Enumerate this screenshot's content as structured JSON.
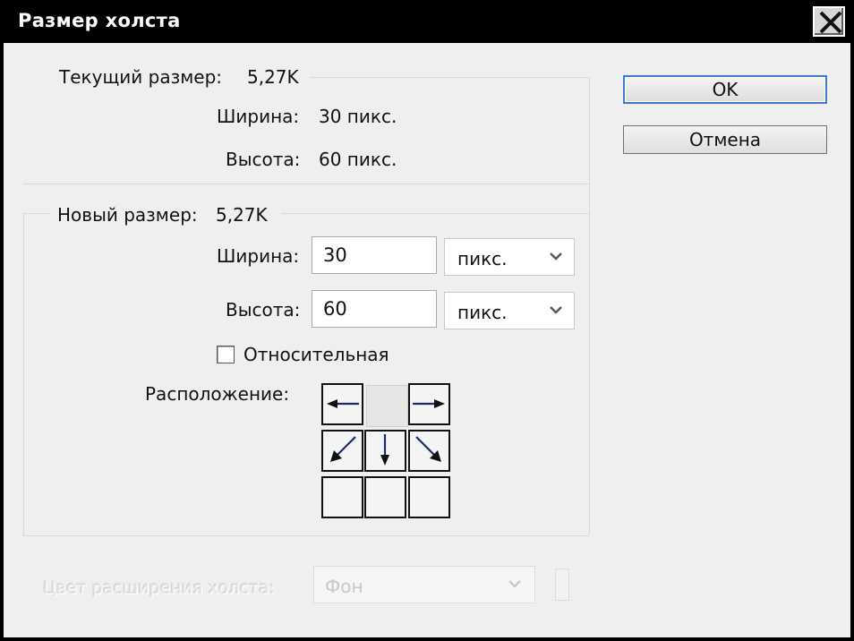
{
  "window": {
    "title": "Размер холста"
  },
  "current_size": {
    "label": "Текущий размер:",
    "value": "5,27K",
    "width_label": "Ширина:",
    "width_value": "30 пикс.",
    "height_label": "Высота:",
    "height_value": "60 пикс."
  },
  "new_size": {
    "label": "Новый размер:",
    "value": "5,27K",
    "width_label": "Ширина:",
    "width_value": "30",
    "width_unit": "пикс.",
    "height_label": "Высота:",
    "height_value": "60",
    "height_unit": "пикс.",
    "relative_label": "Относительная",
    "relative_checked": false,
    "anchor_label": "Расположение:",
    "anchor_position": "top-center"
  },
  "buttons": {
    "ok": "OK",
    "cancel": "Отмена"
  },
  "extension_color": {
    "label": "Цвет расширения холста:",
    "value": "Фон",
    "enabled": false
  },
  "icons": [
    "close-icon",
    "chevron-down-icon",
    "checkbox-icon",
    "arrow-left-icon",
    "arrow-right-icon",
    "arrow-down-left-icon",
    "arrow-down-icon",
    "arrow-down-right-icon"
  ],
  "colors": {
    "titlebar": "#000000",
    "dialog_bg": "#efefef",
    "default_button_border": "#3d7bd3"
  }
}
